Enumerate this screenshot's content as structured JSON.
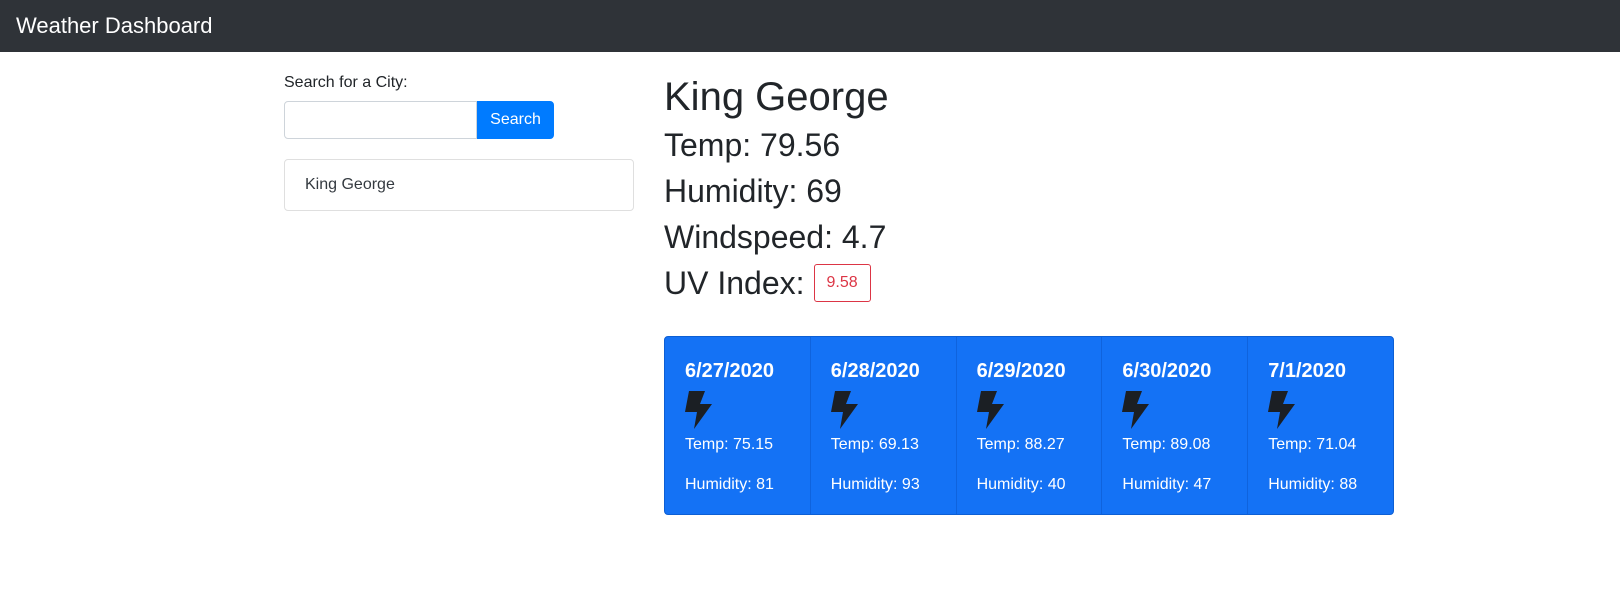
{
  "navbar": {
    "title": "Weather Dashboard"
  },
  "search": {
    "label": "Search for a City:",
    "input_value": "",
    "placeholder": "",
    "button_label": "Search"
  },
  "history": [
    {
      "label": "King George"
    }
  ],
  "current": {
    "city": "King George",
    "temp": "Temp: 79.56",
    "humidity": "Humidity: 69",
    "windspeed": "Windspeed: 4.7",
    "uv_label": "UV Index:",
    "uv_value": "9.58"
  },
  "forecast": [
    {
      "date": "6/27/2020",
      "icon": "lightning-icon",
      "temp": "Temp: 75.15",
      "humidity": "Humidity: 81"
    },
    {
      "date": "6/28/2020",
      "icon": "lightning-icon",
      "temp": "Temp: 69.13",
      "humidity": "Humidity: 93"
    },
    {
      "date": "6/29/2020",
      "icon": "lightning-icon",
      "temp": "Temp: 88.27",
      "humidity": "Humidity: 40"
    },
    {
      "date": "6/30/2020",
      "icon": "lightning-icon",
      "temp": "Temp: 89.08",
      "humidity": "Humidity: 47"
    },
    {
      "date": "7/1/2020",
      "icon": "lightning-icon",
      "temp": "Temp: 71.04",
      "humidity": "Humidity: 88"
    }
  ],
  "colors": {
    "navbar_bg": "#2f3338",
    "primary": "#007bff",
    "forecast_bg": "#1472f5",
    "uv_danger": "#dc3545"
  }
}
